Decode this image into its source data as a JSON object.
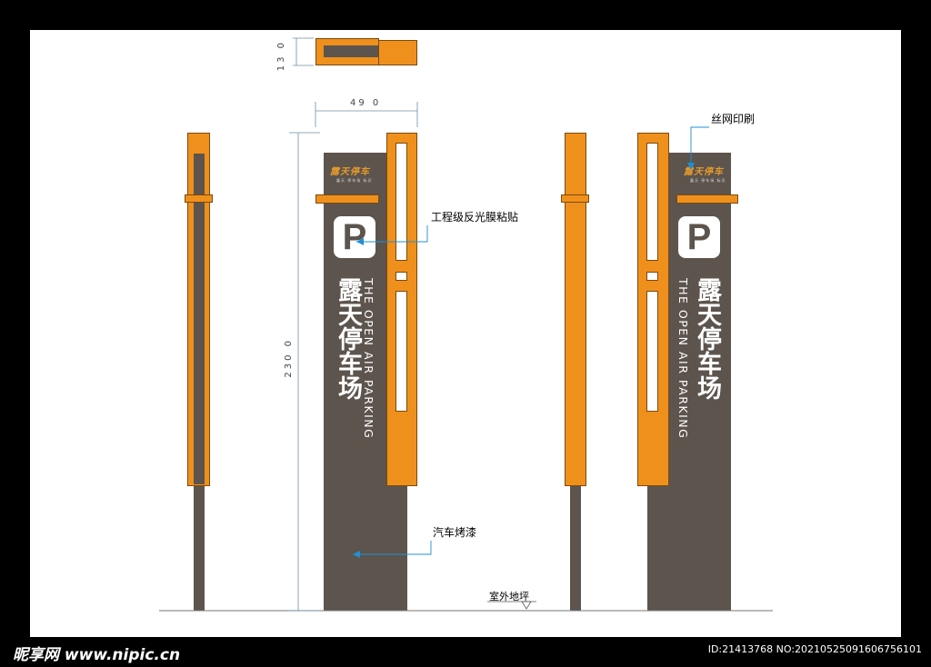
{
  "sign": {
    "cn_title": "露天停车场",
    "en_title": "THE OPEN AIR PARKING",
    "p_symbol": "P",
    "logo_text": "露天停车",
    "logo_sub": "露天 停车场 标识"
  },
  "dimensions": {
    "top_depth": "13 0",
    "width": "49 0",
    "height": "230 0"
  },
  "annotations": {
    "reflective_film": "工程级反光膜粘贴",
    "car_paint": "汽车烤漆",
    "screen_print": "丝网印刷",
    "ground": "室外地坪"
  },
  "footer": {
    "site": "昵享网 www.nipic.cn",
    "id": "ID:21413768 NO:20210525091606756101"
  },
  "colors": {
    "orange": "#f0901c",
    "brown": "#5c544d",
    "annotation_line": "#1f8fd6"
  }
}
